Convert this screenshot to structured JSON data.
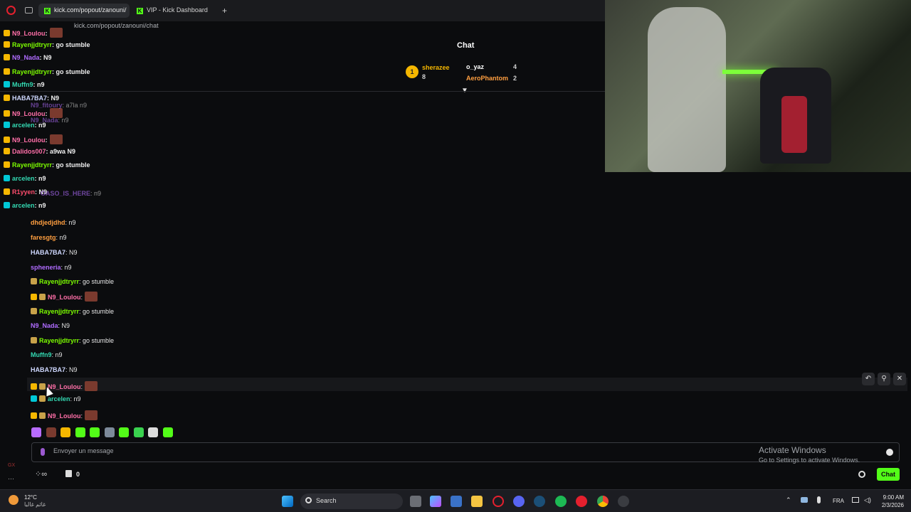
{
  "browser": {
    "tabs": [
      {
        "label": "kick.com/popout/zanouni/"
      },
      {
        "label": "VIP - Kick Dashboard"
      }
    ],
    "url": "kick.com/popout/zanouni/chat"
  },
  "chat": {
    "title": "Chat",
    "leaderboard": [
      {
        "rank": "1",
        "name": "sherazee",
        "count": "8"
      },
      {
        "name": "o_yaz",
        "count": "4"
      },
      {
        "name": "AeroPhantom",
        "count": "2"
      }
    ],
    "overlay_messages": [
      {
        "user": "N9_Loulou",
        "text": ":",
        "color": "#ff6fa8"
      },
      {
        "user": "Rayenjjdtryrr",
        "text": ": go stumble",
        "color": "#7cfc00"
      },
      {
        "user": "N9_Nada",
        "text": ": N9",
        "color": "#b06cff"
      },
      {
        "user": "Rayenjjdtryrr",
        "text": ": go stumble",
        "color": "#7cfc00"
      },
      {
        "user": "Muffn9",
        "text": ": n9",
        "color": "#33d9b2"
      },
      {
        "user": "HABA7BA7",
        "text": ": N9",
        "color": "#cfd8ff"
      },
      {
        "user": "N9_Loulou",
        "text": ":",
        "color": "#ff6fa8"
      },
      {
        "user": "arcelen",
        "text": ": n9",
        "color": "#33d9b2"
      },
      {
        "user": "N9_Loulou",
        "text": ":",
        "color": "#ff6fa8"
      },
      {
        "user": "Dalidos007",
        "text": ": a9wa N9",
        "color": "#ff6fa8"
      },
      {
        "user": "Rayenjjdtryrr",
        "text": ": go stumble",
        "color": "#7cfc00"
      },
      {
        "user": "arcelen",
        "text": ": n9",
        "color": "#33d9b2"
      },
      {
        "user": "R1yyen",
        "text": ": N9",
        "color": "#ff4d6d"
      },
      {
        "user": "arcelen",
        "text": ": n9",
        "color": "#33d9b2"
      }
    ],
    "faded_messages": [
      {
        "user": "N9_fitoury",
        "text": ": a7la n9"
      },
      {
        "user": "N9_Nada",
        "text": ": n9"
      },
      {
        "user": "OASO_IS_HERE",
        "text": ": n9"
      }
    ],
    "messages": [
      {
        "user": "dhdjedjdhd",
        "text": ": n9",
        "color": "#ff9f40"
      },
      {
        "user": "faresgtg",
        "text": ": n9",
        "color": "#ff9f40"
      },
      {
        "user": "HABA7BA7",
        "text": ": N9",
        "color": "#cfd8ff"
      },
      {
        "user": "spheneria",
        "text": ": n9",
        "color": "#b06cff"
      },
      {
        "user": "Rayenjjdtryrr",
        "text": ": go stumble",
        "color": "#7cfc00"
      },
      {
        "user": "N9_Loulou",
        "text": ":",
        "color": "#ff6fa8"
      },
      {
        "user": "Rayenjjdtryrr",
        "text": ": go stumble",
        "color": "#7cfc00"
      },
      {
        "user": "N9_Nada",
        "text": ": N9",
        "color": "#b06cff"
      },
      {
        "user": "Rayenjjdtryrr",
        "text": ": go stumble",
        "color": "#7cfc00"
      },
      {
        "user": "Muffn9",
        "text": ": n9",
        "color": "#33d9b2"
      },
      {
        "user": "HABA7BA7",
        "text": ": N9",
        "color": "#cfd8ff"
      },
      {
        "user": "N9_Loulou",
        "text": ":",
        "color": "#ff6fa8"
      },
      {
        "user": "arcelen",
        "text": ": n9",
        "color": "#33d9b2"
      },
      {
        "user": "N9_Loulou",
        "text": ":",
        "color": "#ff6fa8"
      }
    ],
    "input_placeholder": "Envoyer un message",
    "send_label": "Chat",
    "gift_count": "0"
  },
  "watermark": {
    "line1": "Activate Windows",
    "line2": "Go to Settings to activate Windows."
  },
  "taskbar": {
    "weather_temp": "12°C",
    "weather_desc": "غائم غالبا",
    "search_label": "Search",
    "lang": "FRA",
    "time": "9:00 AM",
    "date": "2/3/2026"
  }
}
